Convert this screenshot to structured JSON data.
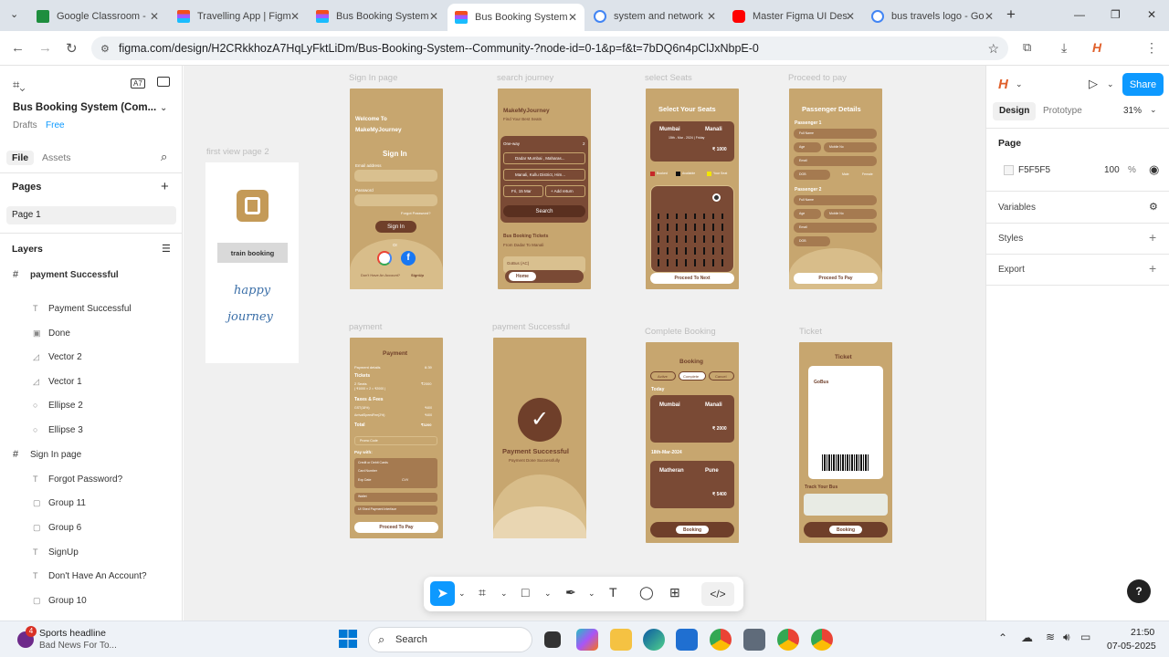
{
  "browser": {
    "tabs": [
      {
        "title": "Google Classroom - ",
        "color": "#1e8e3e"
      },
      {
        "title": "Travelling App | Figm",
        "color": "#f24e1e"
      },
      {
        "title": "Bus Booking System ",
        "color": "#f24e1e"
      },
      {
        "title": "Bus Booking System ",
        "color": "#f24e1e",
        "active": true
      },
      {
        "title": "system and network ",
        "color": "#4285f4"
      },
      {
        "title": "Master Figma UI Des",
        "color": "#ff0000"
      },
      {
        "title": "bus travels logo - Go",
        "color": "#4285f4"
      }
    ],
    "new_tab": "+",
    "url": "figma.com/design/H2CRkkhozA7HqLyFktLiDm/Bus-Booking-System--Community-?node-id=0-1&p=f&t=7bDQ6n4pClJxNbpE-0"
  },
  "figma": {
    "file_title": "Bus Booking System (Com...",
    "drafts": "Drafts",
    "plan": "Free",
    "file_tab": "File",
    "assets_tab": "Assets",
    "pages_heading": "Pages",
    "page1": "Page 1",
    "layers_heading": "Layers",
    "layers": [
      {
        "name": "payment Successful",
        "type": "frame"
      },
      {
        "name": "Payment Successful",
        "type": "text"
      },
      {
        "name": "Done",
        "type": "image"
      },
      {
        "name": "Vector 2",
        "type": "vector"
      },
      {
        "name": "Vector 1",
        "type": "vector"
      },
      {
        "name": "Ellipse 2",
        "type": "ellipse"
      },
      {
        "name": "Ellipse 3",
        "type": "ellipse"
      },
      {
        "name": "Sign In page",
        "type": "frame"
      },
      {
        "name": "Forgot Password?",
        "type": "text"
      },
      {
        "name": "Group 11",
        "type": "group"
      },
      {
        "name": "Group 6",
        "type": "group"
      },
      {
        "name": "SignUp",
        "type": "text"
      },
      {
        "name": "Don't Have An Account?",
        "type": "text"
      },
      {
        "name": "Group 10",
        "type": "group"
      }
    ],
    "right": {
      "share": "Share",
      "design_tab": "Design",
      "prototype_tab": "Prototype",
      "zoom": "31%",
      "page_heading": "Page",
      "bg_hex": "F5F5F5",
      "bg_opacity": "100",
      "pct": "%",
      "variables": "Variables",
      "styles": "Styles",
      "export": "Export"
    },
    "help": "?"
  },
  "canvas": {
    "labels": {
      "first_view": "first view page 2",
      "sign_in": "Sign In page",
      "search": "search journey",
      "seats": "select Seats",
      "proceed": "Proceed to pay",
      "payment": "payment",
      "payment_success": "payment Successful",
      "complete": "Complete  Booking",
      "ticket": "Ticket"
    },
    "first_view": {
      "button": "train booking",
      "script1": "happy",
      "script2": "journey"
    },
    "signin": {
      "welcome": "Welcome To",
      "brand": "MakeMyJourney",
      "heading": "Sign In",
      "email": "Email address",
      "password": "Password",
      "forgot": "Forgot Password?",
      "button": "Sign In",
      "or": "Or",
      "footer": "Don't Have An Account?",
      "signup": "SignUp"
    },
    "search": {
      "brand": "MakeMyJourney",
      "sub": "Find Your Best Seats",
      "oneway": "One-way",
      "pax": "2",
      "from": "Dadar Mumbai , Maharas...",
      "to": "Manali, Kullu District, Him...",
      "date": "Fri, 15 Mar",
      "addreturn": "+ Add return",
      "button": "Search",
      "section": "Bus Booking Tickets",
      "route": "From Dadar To Manali",
      "card": "GoBus  (AC)",
      "nav_home": "Home"
    },
    "seats": {
      "title": "Select Your Seats",
      "from": "Mumbai",
      "to": "Manali",
      "date": "15th - Mar - 2024 | Friday",
      "price": "₹ 1000",
      "legend1": "Booked",
      "legend2": "Available",
      "legend3": "Your Seat",
      "button": "Proceed To Next"
    },
    "passenger": {
      "title": "Passenger Details",
      "p1": "Passenger 1",
      "p2": "Passenger 2",
      "fullname": "Full Name",
      "age": "Age",
      "mobile": "Mobile No",
      "email": "Email",
      "dob": "DOB",
      "male": "Male",
      "female": "Female",
      "button": "Proceed To Pay"
    },
    "payment": {
      "title": "Payment",
      "details": "Payment details",
      "timer": "6:39",
      "tickets": "Tickets",
      "seats_line": "2 Seats",
      "calc": "( ₹1000 × 2 = ₹2000 )",
      "amount1": "₹2000",
      "taxes": "Taxes & Fees",
      "gst": "GST(18%)",
      "gst_amt": "₹400",
      "fee": "ArrivalSpeedFee(2%)",
      "fee_amt": "₹400",
      "total": "Total",
      "total_amt": "₹3200",
      "promo": "Promo Code",
      "paywith": "Pay with:",
      "card": "Credit or Debit Cards",
      "cardno": "Card Number",
      "exp": "Exp Date",
      "cvv": "CVV",
      "wallet": "Wallet",
      "upi": "UI Shed Payment Interface",
      "button": "Proceed To Pay"
    },
    "success": {
      "title": "Payment Successful",
      "sub": "Payment Done Successfully"
    },
    "complete": {
      "title": "Booking",
      "tab1": "Active",
      "tab2": "Complete",
      "tab3": "Cancel",
      "today": "Today",
      "from1": "Mumbai",
      "to1": "Manali",
      "price1": "₹ 2000",
      "date2": "18th-Mar-2024",
      "from2": "Matheran",
      "to2": "Pune",
      "price2": "₹ 5400",
      "nav": "Booking"
    },
    "ticket": {
      "title": "Ticket",
      "operator": "GoBus",
      "track": "Track Your Bus",
      "nav": "Booking"
    }
  },
  "taskbar": {
    "news_title": "Sports headline",
    "news_sub": "Bad News For To...",
    "badge": "4",
    "search": "Search",
    "time": "21:50",
    "date": "07-05-2025"
  }
}
